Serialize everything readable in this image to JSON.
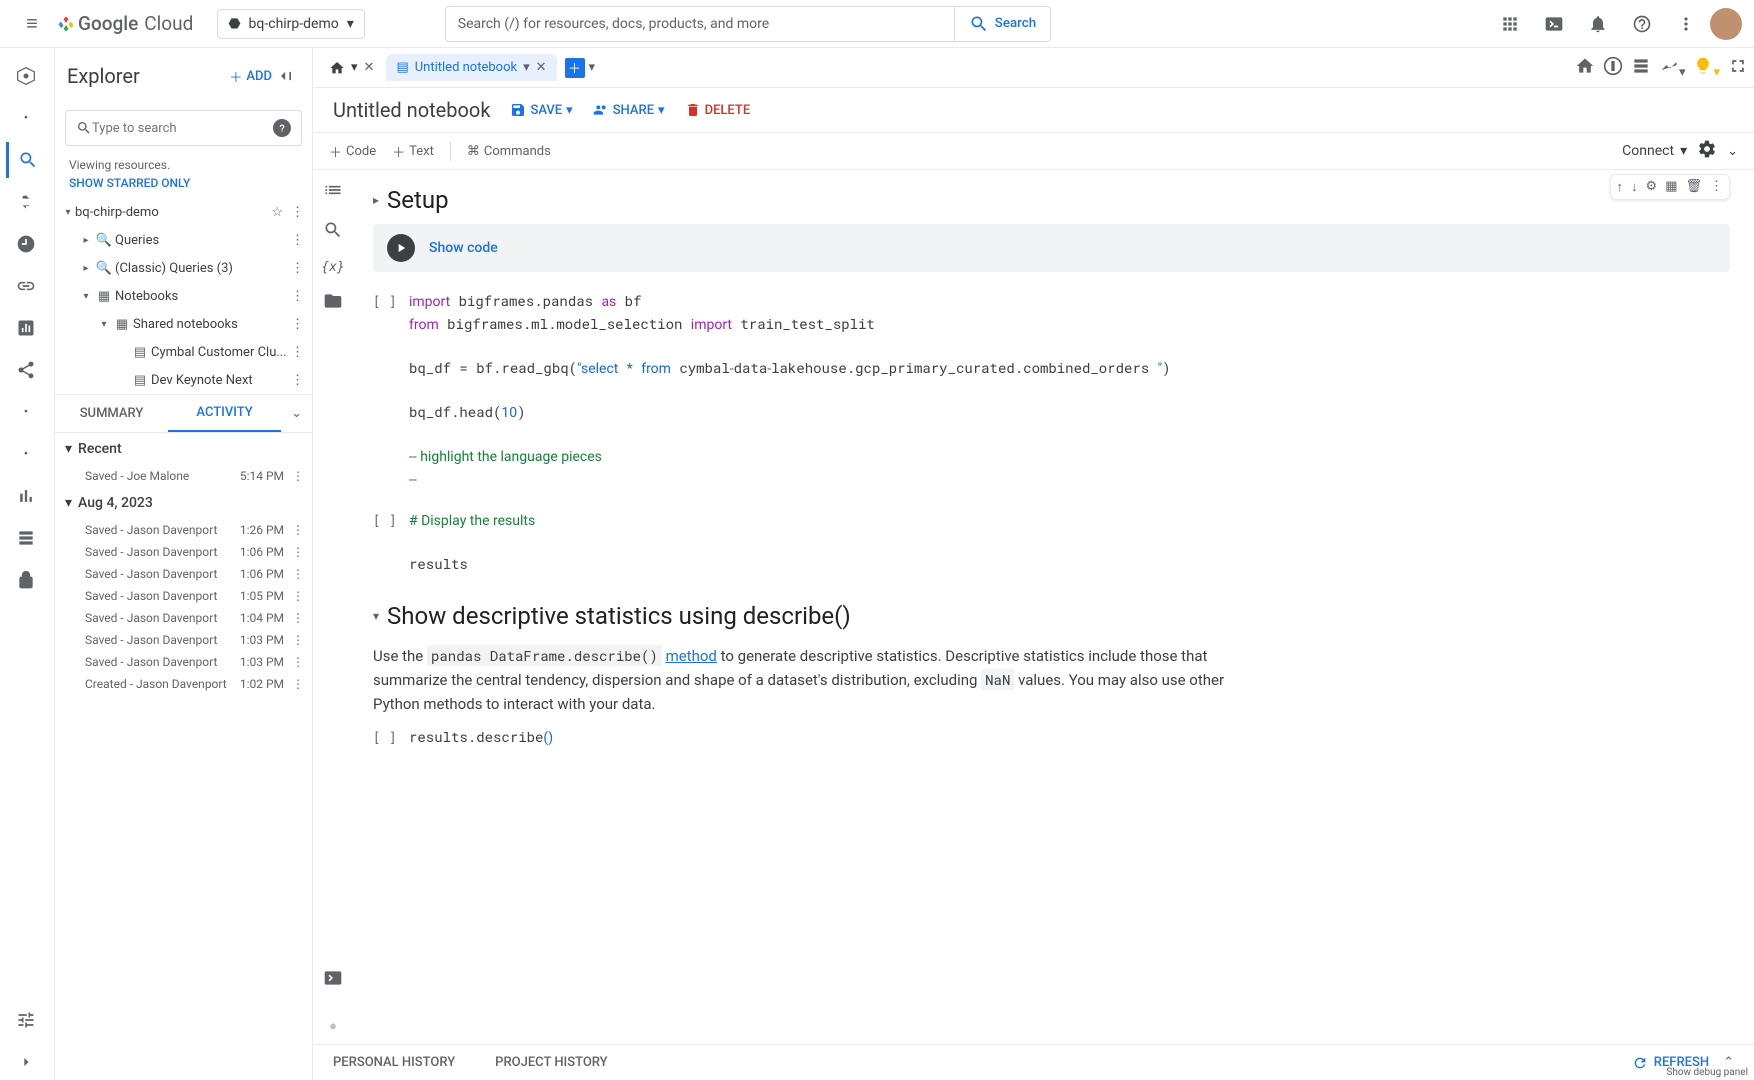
{
  "header": {
    "search_placeholder": "Search (/) for resources, docs, products, and more",
    "search_btn": "Search",
    "project_name": "bq-chirp-demo"
  },
  "explorer": {
    "title": "Explorer",
    "add": "ADD",
    "search_placeholder": "Type to search",
    "viewing": "Viewing resources.",
    "starred_link": "SHOW STARRED ONLY",
    "tree": {
      "project": "bq-chirp-demo",
      "queries": "Queries",
      "classic": "(Classic) Queries (3)",
      "notebooks": "Notebooks",
      "shared": "Shared notebooks",
      "nb1": "Cymbal Customer Clu...",
      "nb2": "Dev Keynote Next"
    },
    "tabs": {
      "summary": "SUMMARY",
      "activity": "ACTIVITY"
    },
    "activity": {
      "recent_hdr": "Recent",
      "recent": [
        {
          "label": "Saved - Joe Malone",
          "time": "5:14 PM"
        }
      ],
      "date_hdr": "Aug 4, 2023",
      "items": [
        {
          "label": "Saved - Jason Davenport",
          "time": "1:26 PM"
        },
        {
          "label": "Saved - Jason Davenport",
          "time": "1:06 PM"
        },
        {
          "label": "Saved - Jason Davenport",
          "time": "1:06 PM"
        },
        {
          "label": "Saved - Jason Davenport",
          "time": "1:05 PM"
        },
        {
          "label": "Saved - Jason Davenport",
          "time": "1:04 PM"
        },
        {
          "label": "Saved - Jason Davenport",
          "time": "1:03 PM"
        },
        {
          "label": "Saved - Jason Davenport",
          "time": "1:03 PM"
        },
        {
          "label": "Created - Jason Davenport",
          "time": "1:02 PM"
        }
      ]
    }
  },
  "tabs": {
    "untitled": "Untitled notebook"
  },
  "notebook": {
    "title": "Untitled notebook",
    "save": "SAVE",
    "share": "SHARE",
    "delete": "DELETE",
    "toolbar": {
      "code": "Code",
      "text": "Text",
      "commands": "Commands",
      "connect": "Connect"
    },
    "cells": {
      "setup_hdr": "Setup",
      "show_code": "Show code",
      "desc_hdr": "Show descriptive statistics using describe()",
      "desc_p_pre": "Use the ",
      "desc_code1": "pandas DataFrame.describe()",
      "desc_method": "method",
      "desc_p_mid": " to generate descriptive statistics. Descriptive statistics include those that summarize the central tendency, dispersion and shape of a dataset's distribution, excluding ",
      "desc_nan": "NaN",
      "desc_p_post": " values. You may also use other Python methods to interact with your data."
    }
  },
  "history": {
    "personal": "PERSONAL HISTORY",
    "project": "PROJECT HISTORY",
    "refresh": "REFRESH",
    "debug": "Show debug panel"
  }
}
